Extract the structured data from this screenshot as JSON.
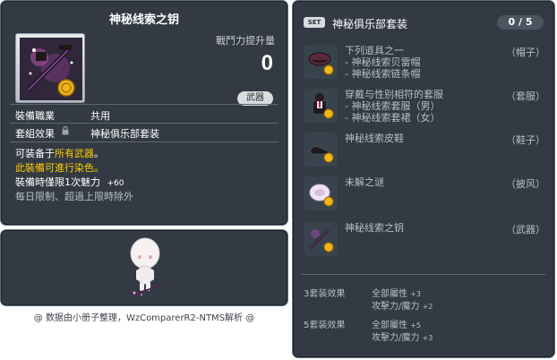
{
  "item_code": "01703037",
  "item": {
    "name": "神秘线索之钥",
    "stat_label": "戰鬥力提升量",
    "stat_value": "0",
    "type_badge": "武器",
    "job_label": "裝備職業",
    "job_value": "共用",
    "set_label": "套組效果",
    "set_value": "神秘俱乐部套装",
    "desc_prefix": "可装备于",
    "desc_highlight": "所有武器",
    "desc_suffix": "。",
    "dye_text": "此裝備可進行染色。",
    "charm_text": "裝備時僅限1次魅力",
    "charm_value": "+60",
    "daily_limit": "每日限制、超過上限時除外"
  },
  "credit": "@ 数据由小册子整理，WzComparerR2-NTMS解析 @",
  "set": {
    "badge": "SET",
    "name": "神秘俱乐部套装",
    "count": "0 / 5",
    "items": [
      {
        "lines": [
          "下列道具之一",
          "- 神秘线索贝雷帽",
          "- 神秘线索链条帽"
        ],
        "category": "（帽子）"
      },
      {
        "lines": [
          "穿戴与性别相符的套服",
          "- 神秘线索套服（男）",
          "- 神秘线索套裙（女）"
        ],
        "category": "（套服）"
      },
      {
        "lines": [
          "神秘线索皮鞋"
        ],
        "category": "（鞋子）"
      },
      {
        "lines": [
          "未解之谜"
        ],
        "category": "（披风）"
      },
      {
        "lines": [
          "神秘线索之钥"
        ],
        "category": "（武器）"
      }
    ],
    "bonuses": [
      {
        "label": "3套装效果",
        "stats": [
          {
            "name": "全部屬性",
            "value": "+3"
          },
          {
            "name": "攻擊力/魔力",
            "value": "+2"
          }
        ]
      },
      {
        "label": "5套装效果",
        "stats": [
          {
            "name": "全部屬性",
            "value": "+5"
          },
          {
            "name": "攻擊力/魔力",
            "value": "+3"
          }
        ]
      }
    ]
  }
}
